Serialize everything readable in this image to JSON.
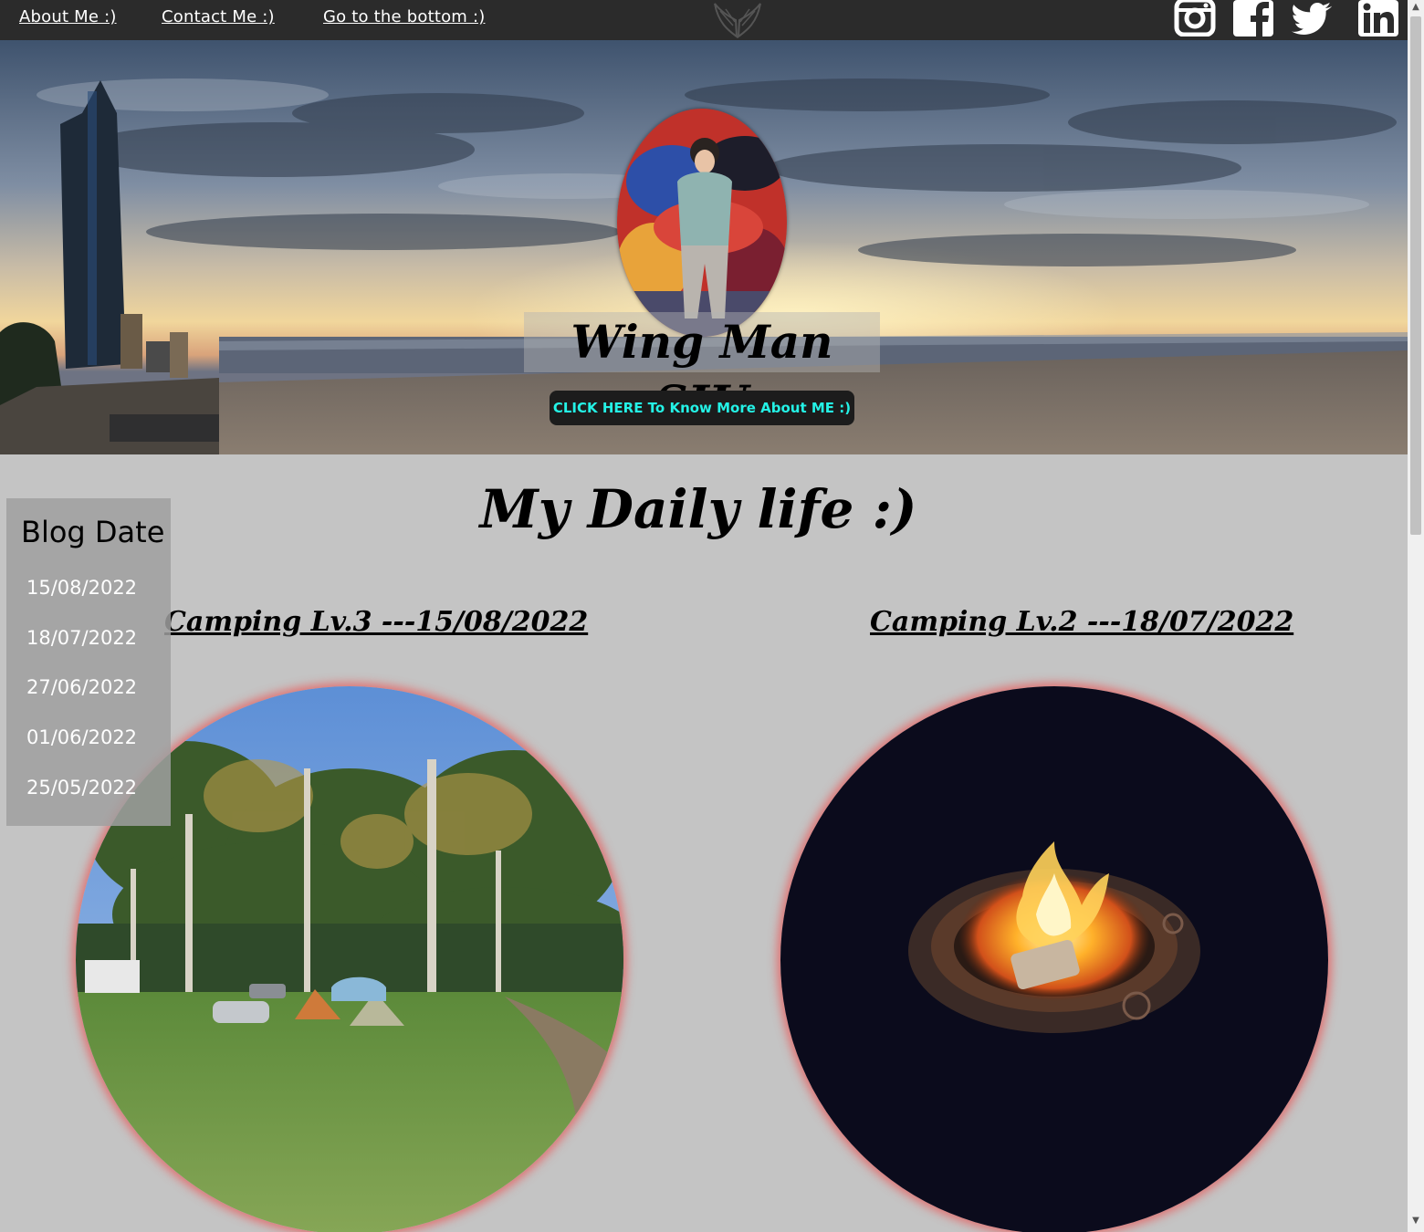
{
  "nav": {
    "about": "About Me :)",
    "contact": "Contact Me :)",
    "bottom": "Go to the bottom :)"
  },
  "social": [
    "instagram-icon",
    "facebook-icon",
    "twitter-icon",
    "linkedin-icon"
  ],
  "hero": {
    "name": "Wing Man SIU",
    "button": "CLICK HERE To Know More About ME :)"
  },
  "main": {
    "title": "My Daily life :)"
  },
  "posts": [
    {
      "title": "Camping Lv.3 ---15/08/2022"
    },
    {
      "title": "Camping Lv.2 ---18/07/2022"
    }
  ],
  "sidebar": {
    "title": "Blog Date",
    "dates": [
      "15/08/2022",
      "18/07/2022",
      "27/06/2022",
      "01/06/2022",
      "25/05/2022"
    ]
  },
  "colors": {
    "nav_bg": "#2b2b2b",
    "page_bg": "#c4c4c4",
    "button_text": "#24f2e6",
    "image_glow": "#e85a5a"
  }
}
